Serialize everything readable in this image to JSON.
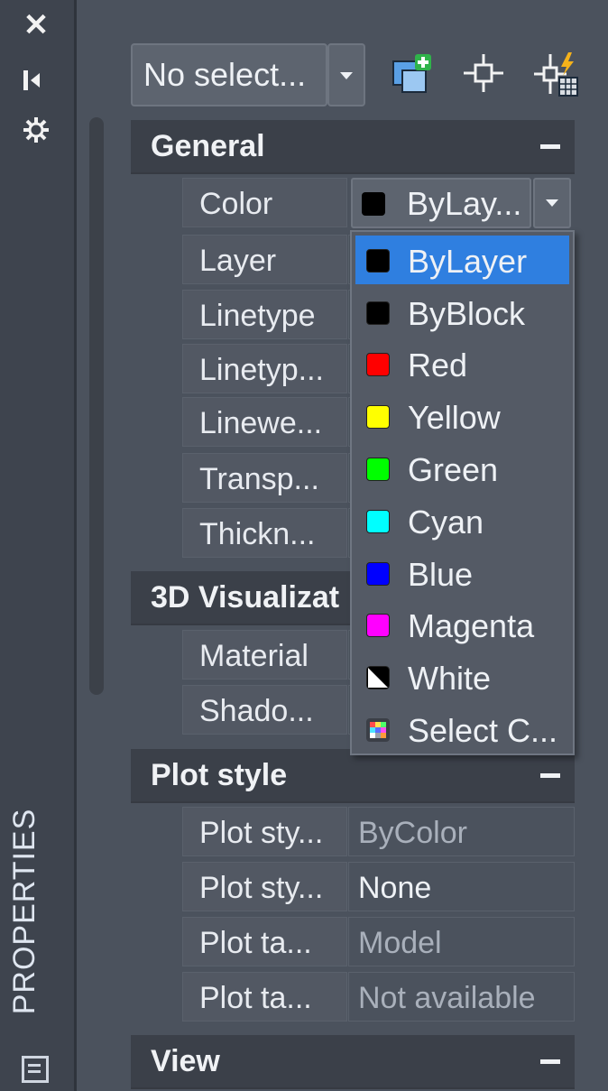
{
  "window": {
    "palette_title": "PROPERTIES"
  },
  "toolbar": {
    "selection_value": "No select...",
    "icons": [
      "quick-select-icon",
      "select-objects-icon",
      "toggle-pickadd-icon"
    ]
  },
  "side_strip": {
    "icons": [
      "close-icon",
      "auto-hide-icon",
      "settings-icon",
      "palette-icon"
    ]
  },
  "sections": {
    "general": {
      "title": "General",
      "rows": [
        {
          "name": "Color",
          "value": "ByLay..."
        },
        {
          "name": "Layer",
          "value": ""
        },
        {
          "name": "Linetype",
          "value": ""
        },
        {
          "name": "Linetyp...",
          "value": ""
        },
        {
          "name": "Linewe...",
          "value": ""
        },
        {
          "name": "Transp...",
          "value": ""
        },
        {
          "name": "Thickn...",
          "value": ""
        }
      ]
    },
    "visualization": {
      "title": "3D Visualizat",
      "rows": [
        {
          "name": "Material",
          "value": ""
        },
        {
          "name": "Shado...",
          "value": ""
        }
      ]
    },
    "plot_style": {
      "title": "Plot style",
      "rows": [
        {
          "name": "Plot sty...",
          "value": "ByColor"
        },
        {
          "name": "Plot sty...",
          "value": "None"
        },
        {
          "name": "Plot ta...",
          "value": "Model"
        },
        {
          "name": "Plot ta...",
          "value": "Not available"
        }
      ]
    },
    "view": {
      "title": "View"
    }
  },
  "color_dropdown": {
    "selected": "ByLayer",
    "options": [
      {
        "label": "ByLayer",
        "swatch": "#000000"
      },
      {
        "label": "ByBlock",
        "swatch": "#000000"
      },
      {
        "label": "Red",
        "swatch": "#ff0000"
      },
      {
        "label": "Yellow",
        "swatch": "#ffff00"
      },
      {
        "label": "Green",
        "swatch": "#00ff00"
      },
      {
        "label": "Cyan",
        "swatch": "#00ffff"
      },
      {
        "label": "Blue",
        "swatch": "#0000ff"
      },
      {
        "label": "Magenta",
        "swatch": "#ff00ff"
      },
      {
        "label": "White",
        "swatch": "white-black-diagonal"
      },
      {
        "label": "Select C...",
        "swatch": "multicolor"
      }
    ]
  }
}
